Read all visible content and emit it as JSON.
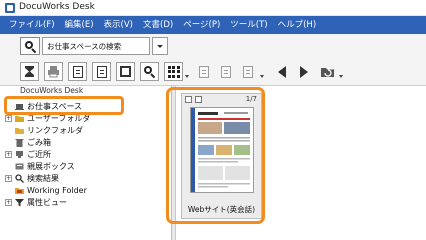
{
  "window": {
    "title": "DocuWorks Desk"
  },
  "menu": {
    "items": [
      "ファイル(F)",
      "編集(E)",
      "表示(V)",
      "文書(D)",
      "ページ(P)",
      "ツール(T)",
      "ヘルプ(H)"
    ]
  },
  "search": {
    "value": "お仕事スペースの検索"
  },
  "tree": {
    "root_label": "DocuWorks Desk",
    "items": [
      {
        "label": "お仕事スペース",
        "icon": "workspace-icon"
      },
      {
        "label": "ユーザーフォルダ",
        "icon": "folder-icon"
      },
      {
        "label": "リンクフォルダ",
        "icon": "link-folder-icon"
      },
      {
        "label": "ごみ箱",
        "icon": "trash-icon"
      },
      {
        "label": "ご近所",
        "icon": "neighborhood-icon"
      },
      {
        "label": "親展ボックス",
        "icon": "mailbox-icon"
      },
      {
        "label": "検索結果",
        "icon": "search-results-icon"
      },
      {
        "label": "Working Folder",
        "icon": "working-folder-icon"
      },
      {
        "label": "属性ビュー",
        "icon": "filter-icon"
      }
    ]
  },
  "document": {
    "label": "Webサイト(英会話)",
    "page_count": "1/7"
  },
  "colors": {
    "menu_bar": "#2f63b8",
    "highlight": "#f28c1e"
  }
}
